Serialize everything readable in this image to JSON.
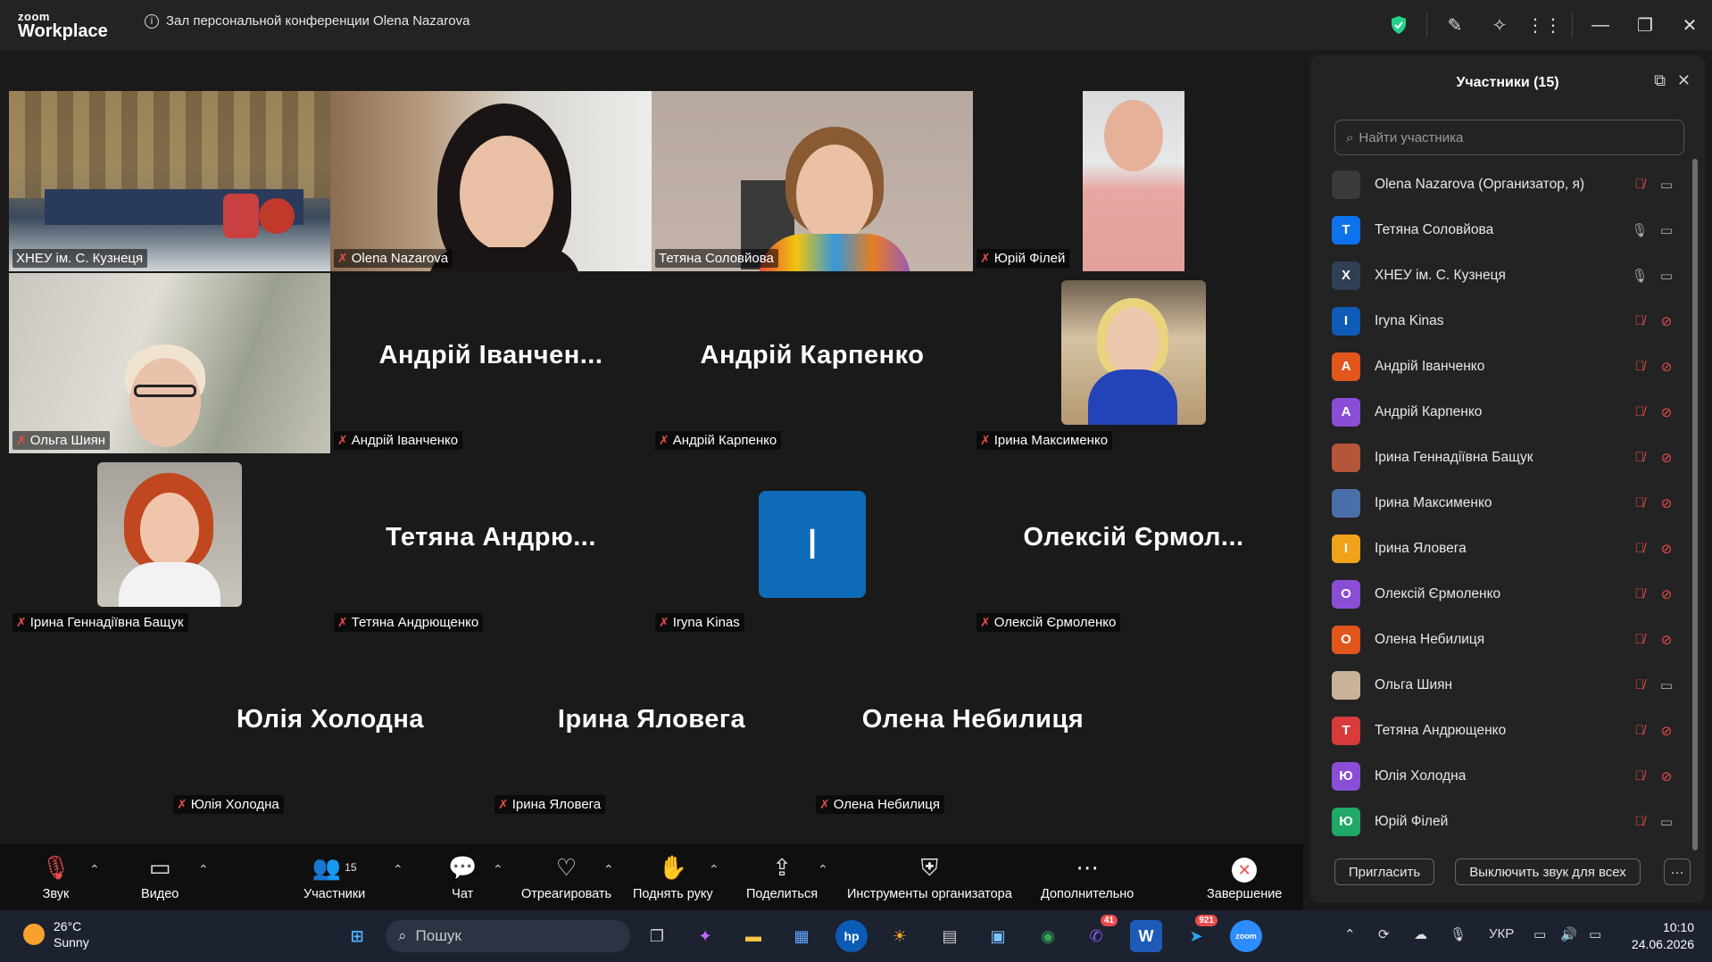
{
  "titlebar": {
    "logo_small": "zoom",
    "logo_big": "Workplace",
    "meeting_title": "Зал персональной конференции Olena Nazarova"
  },
  "tiles": [
    {
      "name": "ХНЕУ ім. С. Кузнеця",
      "muted": false,
      "video": true
    },
    {
      "name": "Olena Nazarova",
      "muted": true,
      "video": true
    },
    {
      "name": "Тетяна Соловйова",
      "muted": false,
      "video": true,
      "active": true
    },
    {
      "name": "Юрій Філей",
      "muted": true,
      "video": true
    },
    {
      "name": "Ольга Шиян",
      "muted": true,
      "video": true
    },
    {
      "name": "Андрій Іванченко",
      "big": "Андрій Іванчен...",
      "muted": true
    },
    {
      "name": "Андрій Карпенко",
      "big": "Андрій Карпенко",
      "muted": true
    },
    {
      "name": "Ірина Максименко",
      "muted": true,
      "photo": true
    },
    {
      "name": "Ірина Геннадіївна Бащук",
      "muted": true,
      "photo": true
    },
    {
      "name": "Тетяна Андрющенко",
      "big": "Тетяна  Андрю...",
      "muted": true
    },
    {
      "name": "Iryna Kinas",
      "avatar_letter": "I",
      "muted": true
    },
    {
      "name": "Олексій Єрмоленко",
      "big": "Олексій Єрмол...",
      "muted": true
    },
    {
      "name": "Юлія Холодна",
      "big": "Юлія Холодна",
      "muted": true
    },
    {
      "name": "Ірина Яловега",
      "big": "Ірина Яловега",
      "muted": true
    },
    {
      "name": "Олена Небилиця",
      "big": "Олена Небилиця",
      "muted": true
    }
  ],
  "panel": {
    "title": "Участники (15)",
    "search_placeholder": "Найти участника",
    "participants": [
      {
        "letter": "",
        "color": "#3a3a3a",
        "name": "Olena Nazarova (Организатор, я)",
        "mic": "muted",
        "cam": "on"
      },
      {
        "letter": "Т",
        "color": "#0e72ed",
        "name": "Тетяна Соловйова",
        "mic": "on",
        "cam": "on"
      },
      {
        "letter": "Х",
        "color": "#2f3f55",
        "name": "ХНЕУ ім. С. Кузнеця",
        "mic": "on",
        "cam": "on"
      },
      {
        "letter": "I",
        "color": "#0e5cb8",
        "name": "Iryna Kinas",
        "mic": "muted",
        "cam": "off"
      },
      {
        "letter": "А",
        "color": "#e0561b",
        "name": "Андрій Іванченко",
        "mic": "muted",
        "cam": "off"
      },
      {
        "letter": "А",
        "color": "#8a4dd6",
        "name": "Андрій Карпенко",
        "mic": "muted",
        "cam": "off"
      },
      {
        "letter": "",
        "color": "#b5553a",
        "name": "Ірина Геннадіївна Бащук",
        "mic": "muted",
        "cam": "off"
      },
      {
        "letter": "",
        "color": "#4a6fa8",
        "name": "Ірина Максименко",
        "mic": "muted",
        "cam": "off"
      },
      {
        "letter": "І",
        "color": "#f0a21a",
        "name": "Ірина Яловега",
        "mic": "muted",
        "cam": "off"
      },
      {
        "letter": "О",
        "color": "#8a4dd6",
        "name": "Олексій Єрмоленко",
        "mic": "muted",
        "cam": "off"
      },
      {
        "letter": "О",
        "color": "#e0561b",
        "name": "Олена Небилиця",
        "mic": "muted",
        "cam": "off"
      },
      {
        "letter": "",
        "color": "#c9b29a",
        "name": "Ольга Шиян",
        "mic": "muted",
        "cam": "on"
      },
      {
        "letter": "Т",
        "color": "#d83b3b",
        "name": "Тетяна Андрющенко",
        "mic": "muted",
        "cam": "off"
      },
      {
        "letter": "Ю",
        "color": "#8a4dd6",
        "name": "Юлія Холодна",
        "mic": "muted",
        "cam": "off"
      },
      {
        "letter": "Ю",
        "color": "#1fa866",
        "name": "Юрій Філей",
        "mic": "muted",
        "cam": "on"
      }
    ],
    "invite_label": "Пригласить",
    "mute_all_label": "Выключить звук для всех",
    "more_label": "···"
  },
  "toolbar": {
    "audio": "Звук",
    "video": "Видео",
    "participants": "Участники",
    "participants_count": "15",
    "chat": "Чат",
    "react": "Отреагировать",
    "raise_hand": "Поднять руку",
    "share": "Поделиться",
    "host_tools": "Инструменты организатора",
    "more": "Дополнительно",
    "end": "Завершение"
  },
  "taskbar": {
    "temp": "26°C",
    "weather": "Sunny",
    "search_placeholder": "Пошук",
    "viber_badge": "41",
    "telegram_badge": "921",
    "lang": "УКР",
    "time": "10:10",
    "date": "24.06.2026"
  },
  "colors": {
    "active_speaker": "#23d18b",
    "muted": "#e84c4c",
    "end_button": "#e84c4c"
  }
}
